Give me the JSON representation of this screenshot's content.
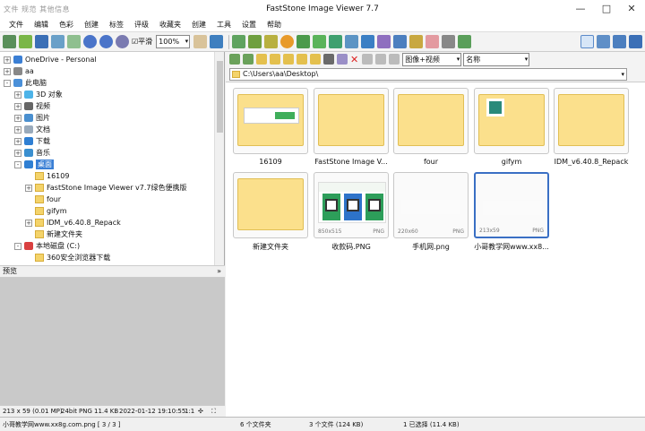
{
  "window": {
    "title": "FastStone Image Viewer 7.7",
    "blurred_prefix": "文件 规范 其他信息"
  },
  "menu": [
    "文件",
    "编辑",
    "色彩",
    "创建",
    "标签",
    "评级",
    "收藏夹",
    "创建",
    "工具",
    "设置",
    "帮助"
  ],
  "toolbar": {
    "zoom_value": "100%",
    "fit_label": "平滑"
  },
  "tree": [
    {
      "label": "OneDrive - Personal",
      "indent": 0,
      "expander": "+",
      "icon": "cloud-icon"
    },
    {
      "label": "aa",
      "indent": 0,
      "expander": "+",
      "icon": "user-icon"
    },
    {
      "label": "此电脑",
      "indent": 0,
      "expander": "-",
      "icon": "computer-icon"
    },
    {
      "label": "3D 对象",
      "indent": 1,
      "expander": "+",
      "icon": "3d-objects-icon"
    },
    {
      "label": "视频",
      "indent": 1,
      "expander": "+",
      "icon": "video-icon"
    },
    {
      "label": "图片",
      "indent": 1,
      "expander": "+",
      "icon": "pictures-icon"
    },
    {
      "label": "文档",
      "indent": 1,
      "expander": "+",
      "icon": "documents-icon"
    },
    {
      "label": "下载",
      "indent": 1,
      "expander": "+",
      "icon": "download-icon"
    },
    {
      "label": "音乐",
      "indent": 1,
      "expander": "+",
      "icon": "music-icon"
    },
    {
      "label": "桌面",
      "indent": 1,
      "expander": "-",
      "icon": "desktop-icon",
      "selected": true
    },
    {
      "label": "16109",
      "indent": 2,
      "expander": "",
      "icon": "folder-icon"
    },
    {
      "label": "FastStone Image Viewer v7.7绿色便携版",
      "indent": 2,
      "expander": "+",
      "icon": "folder-icon"
    },
    {
      "label": "four",
      "indent": 2,
      "expander": "",
      "icon": "folder-icon"
    },
    {
      "label": "gifym",
      "indent": 2,
      "expander": "",
      "icon": "folder-icon"
    },
    {
      "label": "IDM_v6.40.8_Repack",
      "indent": 2,
      "expander": "+",
      "icon": "folder-icon"
    },
    {
      "label": "新建文件夹",
      "indent": 2,
      "expander": "",
      "icon": "folder-icon"
    },
    {
      "label": "本地磁盘 (C:)",
      "indent": 1,
      "expander": "-",
      "icon": "drive-icon"
    },
    {
      "label": "360安全浏览器下载",
      "indent": 2,
      "expander": "",
      "icon": "folder-icon"
    }
  ],
  "preview_label": "预览",
  "nav": {
    "filter_value": "图像+视频",
    "sort_value": "名称"
  },
  "path": "C:\\Users\\aa\\Desktop\\",
  "thumbnails": [
    {
      "caption": "16109",
      "kind": "folder-screenshot"
    },
    {
      "caption": "FastStone Image V...",
      "kind": "folder"
    },
    {
      "caption": "four",
      "kind": "folder"
    },
    {
      "caption": "gifym",
      "kind": "folder-qr"
    },
    {
      "caption": "IDM_v6.40.8_Repack",
      "kind": "folder"
    },
    {
      "caption": "新建文件夹",
      "kind": "folder"
    },
    {
      "caption": "收款码.PNG",
      "kind": "image-qr",
      "dims": "850x515",
      "format": "PNG"
    },
    {
      "caption": "手机网.png",
      "kind": "image-blank",
      "dims": "220x60",
      "format": "PNG"
    },
    {
      "caption": "小哥教学网www.xx8...",
      "kind": "image-blank",
      "dims": "213x59",
      "format": "PNG",
      "active": true
    }
  ],
  "info": {
    "dims": "213 x 59 (0.01 MP)",
    "depth": "24bit",
    "format": "PNG",
    "size": "11.4 KB",
    "date": "2022-01-12 19:10:55",
    "ratio": "1:1"
  },
  "status": {
    "file": "小哥教学网www.xx8g.com.png [ 3 / 3 ]",
    "folders": "6 个文件夹",
    "files": "3 个文件 (124 KB)",
    "selected": "1 已选择 (11.4 KB)"
  }
}
